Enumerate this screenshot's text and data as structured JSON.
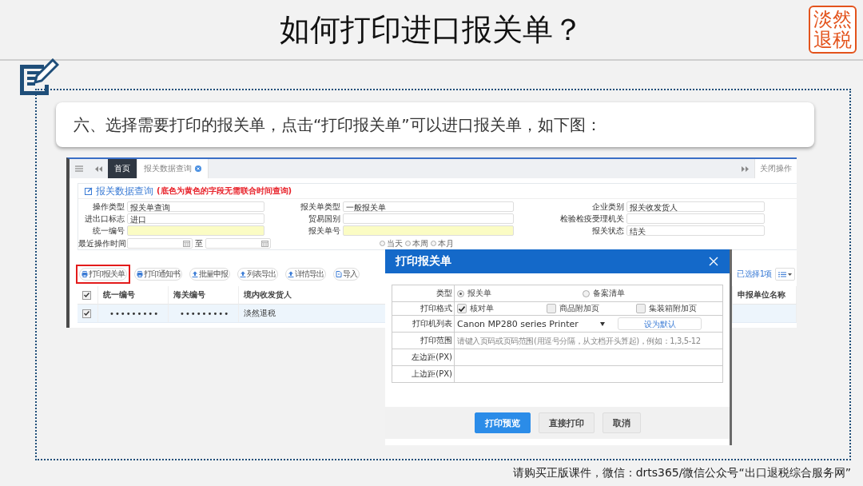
{
  "slide": {
    "title": "如何打印进口报关单？",
    "stamp": "淡然退税",
    "instruction": "六、选择需要打印的报关单，点击“打印报关单”可以进口报关单，如下图：",
    "footer": "请购买正版课件，微信：drts365/微信公众号“出口退税综合服务网”"
  },
  "app": {
    "tabs": [
      {
        "label": "首页",
        "selected": true
      },
      {
        "label": "报关数据查询",
        "selected": false
      }
    ],
    "close_ops": "关闭操作",
    "panel_title": "报关数据查询",
    "panel_note": "(底色为黄色的字段无需联合时间查询)",
    "fields": [
      {
        "label": "操作类型",
        "value": "报关单查询",
        "highlighted": false
      },
      {
        "label": "报关单类型",
        "value": "一般报关单",
        "highlighted": false
      },
      {
        "label": "企业类别",
        "value": "报关收发货人",
        "highlighted": false
      },
      {
        "label": "进出口标志",
        "value": "进口",
        "highlighted": false
      },
      {
        "label": "贸易国别",
        "highlighted": false
      },
      {
        "label": "检验检疫受理机关",
        "highlighted": false
      },
      {
        "label": "统一编号",
        "highlighted": true
      },
      {
        "label": "报关单号",
        "highlighted": true
      },
      {
        "label": "报关状态",
        "value": "结关",
        "highlighted": false
      }
    ],
    "date_label": "最近操作时间",
    "date_to": "至",
    "quick_ranges": [
      {
        "label": "当天",
        "selected": false
      },
      {
        "label": "本周",
        "selected": false
      },
      {
        "label": "本月",
        "selected": false
      }
    ],
    "toolbar": [
      {
        "label": "打印报关单",
        "kind": "print",
        "highlighted": true
      },
      {
        "label": "打印通知书",
        "kind": "print",
        "highlighted": false
      },
      {
        "label": "批量申报",
        "kind": "upload",
        "highlighted": false
      },
      {
        "label": "列表导出",
        "kind": "upload",
        "highlighted": false
      },
      {
        "label": "详情导出",
        "kind": "upload",
        "highlighted": false
      },
      {
        "label": "导入",
        "kind": "import",
        "highlighted": false
      }
    ],
    "selected_count": "已选择1项",
    "table": {
      "header_checked": true,
      "columns": [
        "统一编号",
        "海关编号",
        "境内收发货人",
        "申报单位名称"
      ],
      "rows": [
        {
          "checked": true,
          "cells": [
            "•••••••••",
            "•••••••••",
            "淡然退税"
          ]
        }
      ]
    }
  },
  "dialog": {
    "title": "打印报关单",
    "type_label": "类型",
    "types": [
      {
        "label": "报关单",
        "selected": true
      },
      {
        "label": "备案清单",
        "selected": false
      }
    ],
    "format_label": "打印格式",
    "formats": [
      {
        "label": "核对单",
        "checked": true
      },
      {
        "label": "商品附加页",
        "checked": false
      },
      {
        "label": "集装箱附加页",
        "checked": false
      }
    ],
    "printer_label": "打印机列表",
    "printer": "Canon MP280 series Printer",
    "set_default": "设为默认",
    "range_label": "打印范围",
    "range_placeholder": "请键入页码或页码范围(用逗号分隔，从文档开头算起)，例如：1,3,5-12",
    "left_margin_label": "左边距(PX)",
    "top_margin_label": "上边距(PX)",
    "buttons": [
      {
        "label": "打印预览",
        "kind": "primary"
      },
      {
        "label": "直接打印",
        "kind": "default"
      },
      {
        "label": "取消",
        "kind": "default"
      }
    ]
  }
}
